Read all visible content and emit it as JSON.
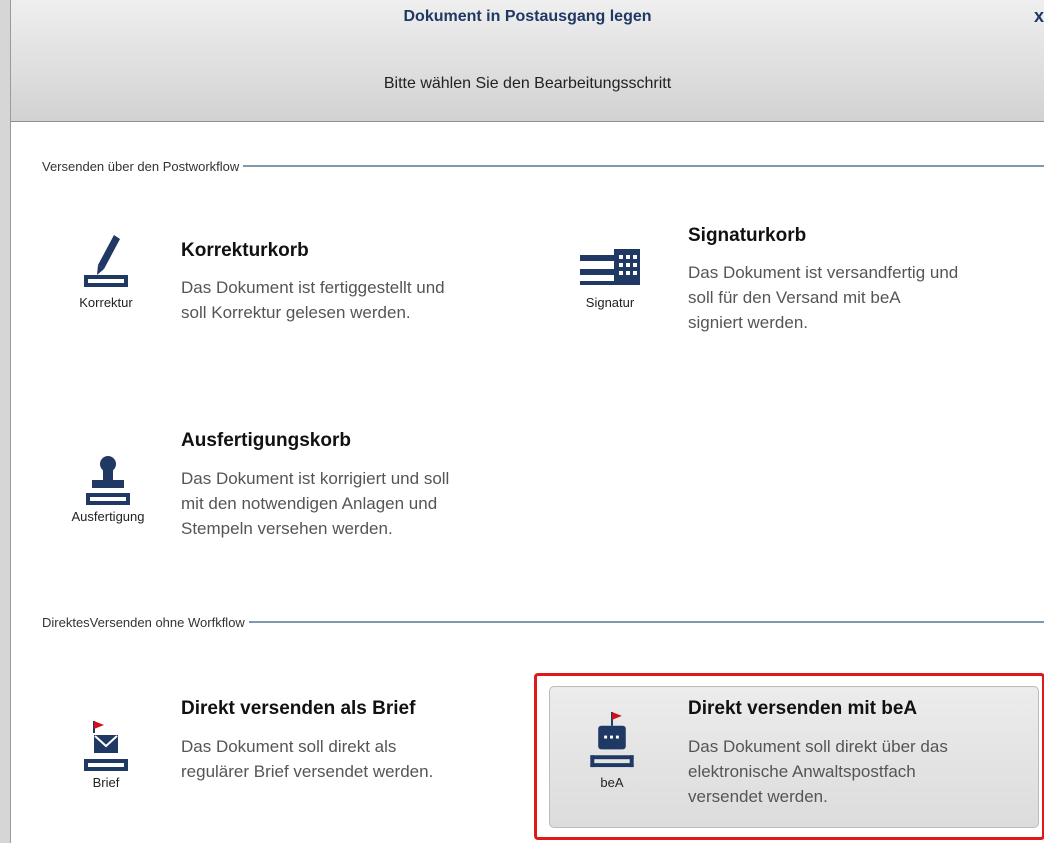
{
  "dialog": {
    "title": "Dokument in Postausgang legen",
    "subtitle": "Bitte wählen Sie den Bearbeitungsschritt",
    "close_symbol": "x"
  },
  "sections": {
    "postworkflow": {
      "label": "Versenden über den Postworkflow"
    },
    "direct": {
      "label": "DirektesVersenden ohne Worfkflow"
    }
  },
  "options": {
    "korrektur": {
      "icon": "pen-icon",
      "icon_label": "Korrektur",
      "title": "Korrekturkorb",
      "description": "Das Dokument ist fertiggestellt und\nsoll Korrektur gelesen werden."
    },
    "signatur": {
      "icon": "signature-tray-icon",
      "icon_label": "Signatur",
      "title": "Signaturkorb",
      "description": "Das Dokument ist versandfertig und\nsoll für den Versand mit beA\nsigniert werden."
    },
    "ausfertigung": {
      "icon": "stamp-icon",
      "icon_label": "Ausfertigung",
      "title": "Ausfertigungskorb",
      "description": "Das Dokument ist korrigiert und soll\nmit den notwendigen Anlagen und\nStempeln versehen werden."
    },
    "brief": {
      "icon": "envelope-icon",
      "icon_label": "Brief",
      "title": "Direkt versenden als Brief",
      "description": "Das Dokument soll direkt als\nregulärer Brief versendet werden."
    },
    "bea": {
      "icon": "bea-mailbox-icon",
      "icon_label": "beA",
      "title": "Direkt versenden mit beA",
      "description": "Das Dokument soll direkt über das\nelektronische Anwaltspostfach\nversendet werden.",
      "selected": true
    }
  },
  "colors": {
    "icon_blue": "#1f3864",
    "flag_red": "#d0101a",
    "highlight_red": "#e01818",
    "section_line": "#7f98b0"
  }
}
